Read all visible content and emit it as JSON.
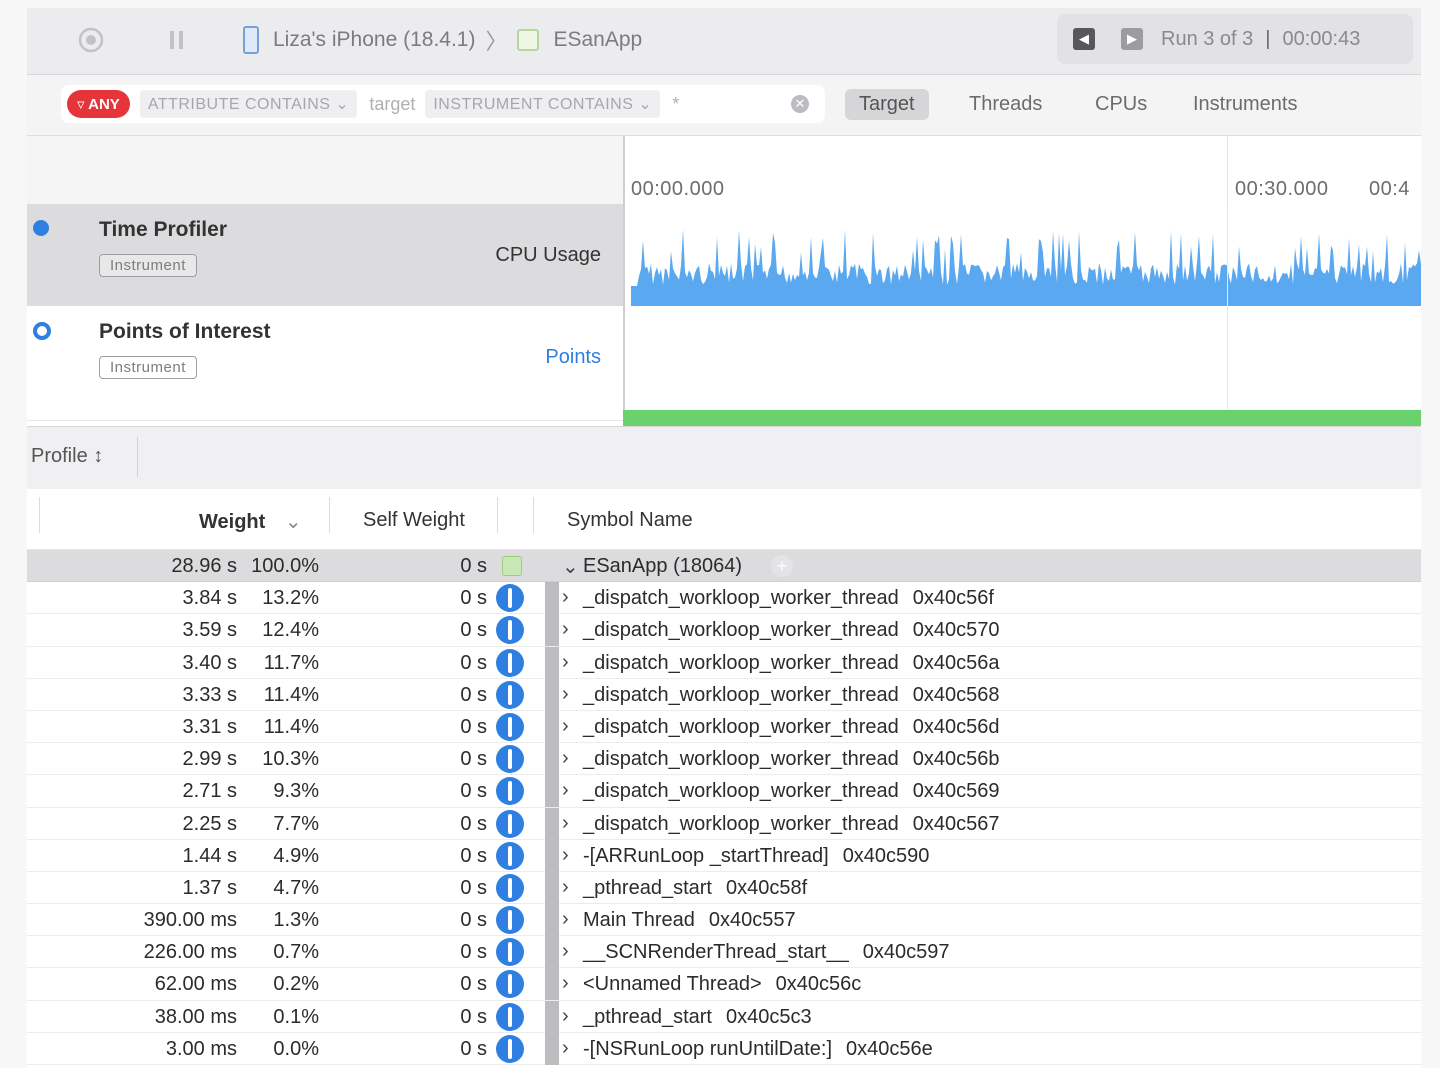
{
  "toolbar": {
    "device": "Liza's iPhone (18.4.1)",
    "app": "ESanApp",
    "run": "Run 3 of 3",
    "separator": "|",
    "elapsed": "00:00:43"
  },
  "filter": {
    "any_label": "ANY",
    "attribute_chip": "ATTRIBUTE CONTAINS",
    "target_text": "target",
    "instrument_chip": "INSTRUMENT CONTAINS",
    "instrument_value": "*",
    "segments": [
      "Target",
      "Threads",
      "CPUs",
      "Instruments"
    ],
    "active_segment": "Target"
  },
  "timeline": {
    "ticks": [
      "00:00.000",
      "00:30.000",
      "00:4"
    ]
  },
  "tracks": [
    {
      "name": "Time Profiler",
      "badge": "Instrument",
      "metric": "CPU Usage",
      "selected": true
    },
    {
      "name": "Points of Interest",
      "badge": "Instrument",
      "metric": "Points",
      "selected": false
    }
  ],
  "profile": {
    "selector": "Profile ↕",
    "headers": {
      "weight": "Weight",
      "self_weight": "Self Weight",
      "symbol": "Symbol Name"
    }
  },
  "rows": [
    {
      "weight": "28.96 s",
      "pct": "100.0%",
      "self": "0 s",
      "symbol": "ESanApp (18064)",
      "addr": "",
      "root": true
    },
    {
      "weight": "3.84 s",
      "pct": "13.2%",
      "self": "0 s",
      "symbol": "_dispatch_workloop_worker_thread",
      "addr": "0x40c56f"
    },
    {
      "weight": "3.59 s",
      "pct": "12.4%",
      "self": "0 s",
      "symbol": "_dispatch_workloop_worker_thread",
      "addr": "0x40c570"
    },
    {
      "weight": "3.40 s",
      "pct": "11.7%",
      "self": "0 s",
      "symbol": "_dispatch_workloop_worker_thread",
      "addr": "0x40c56a"
    },
    {
      "weight": "3.33 s",
      "pct": "11.4%",
      "self": "0 s",
      "symbol": "_dispatch_workloop_worker_thread",
      "addr": "0x40c568"
    },
    {
      "weight": "3.31 s",
      "pct": "11.4%",
      "self": "0 s",
      "symbol": "_dispatch_workloop_worker_thread",
      "addr": "0x40c56d"
    },
    {
      "weight": "2.99 s",
      "pct": "10.3%",
      "self": "0 s",
      "symbol": "_dispatch_workloop_worker_thread",
      "addr": "0x40c56b"
    },
    {
      "weight": "2.71 s",
      "pct": "9.3%",
      "self": "0 s",
      "symbol": "_dispatch_workloop_worker_thread",
      "addr": "0x40c569"
    },
    {
      "weight": "2.25 s",
      "pct": "7.7%",
      "self": "0 s",
      "symbol": "_dispatch_workloop_worker_thread",
      "addr": "0x40c567"
    },
    {
      "weight": "1.44 s",
      "pct": "4.9%",
      "self": "0 s",
      "symbol": "-[ARRunLoop _startThread]",
      "addr": "0x40c590"
    },
    {
      "weight": "1.37 s",
      "pct": "4.7%",
      "self": "0 s",
      "symbol": "_pthread_start",
      "addr": "0x40c58f"
    },
    {
      "weight": "390.00 ms",
      "pct": "1.3%",
      "self": "0 s",
      "symbol": "Main Thread",
      "addr": "0x40c557"
    },
    {
      "weight": "226.00 ms",
      "pct": "0.7%",
      "self": "0 s",
      "symbol": "__SCNRenderThread_start__",
      "addr": "0x40c597"
    },
    {
      "weight": "62.00 ms",
      "pct": "0.2%",
      "self": "0 s",
      "symbol": "<Unnamed Thread>",
      "addr": "0x40c56c"
    },
    {
      "weight": "38.00 ms",
      "pct": "0.1%",
      "self": "0 s",
      "symbol": "_pthread_start",
      "addr": "0x40c5c3"
    },
    {
      "weight": "3.00 ms",
      "pct": "0.0%",
      "self": "0 s",
      "symbol": "-[NSRunLoop runUntilDate:]",
      "addr": "0x40c56e"
    }
  ],
  "colors": {
    "accent": "#2f7fe0",
    "cpu_fill": "#5aa8f0",
    "points_bar": "#69d26c",
    "any_badge": "#e5343a"
  }
}
